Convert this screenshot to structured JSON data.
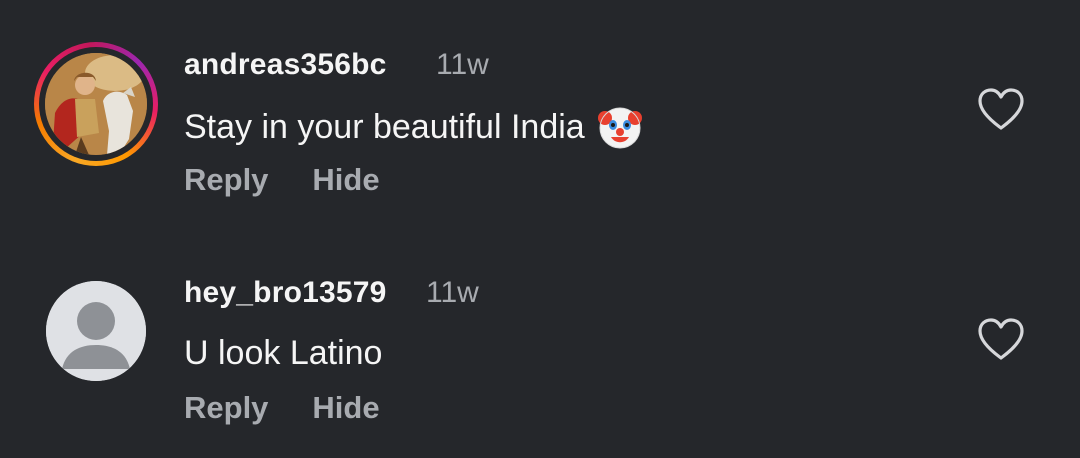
{
  "comments": [
    {
      "username": "andreas356bc",
      "time": "11w",
      "text": "Stay in your beautiful India",
      "emoji_icon": "clown-face-icon",
      "reply_label": "Reply",
      "hide_label": "Hide",
      "avatar": "profile-photo-with-story-ring"
    },
    {
      "username": "hey_bro13579",
      "time": "11w",
      "text": "U look Latino",
      "reply_label": "Reply",
      "hide_label": "Hide",
      "avatar": "default-avatar"
    }
  ],
  "colors": {
    "background": "#25272b",
    "primary_text": "#f5f5f5",
    "secondary_text": "#a8abb0",
    "default_avatar_bg": "#dfe1e5",
    "default_avatar_fg": "#8e9196"
  }
}
